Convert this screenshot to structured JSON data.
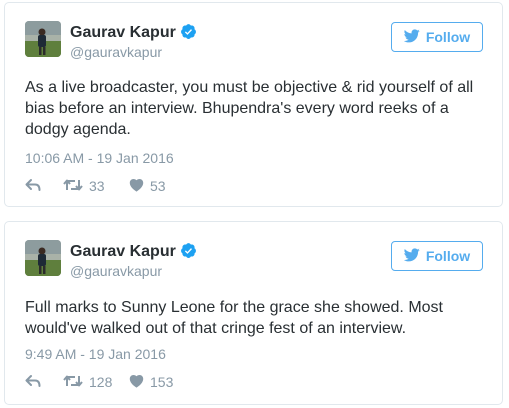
{
  "tweets": [
    {
      "user": {
        "name": "Gaurav Kapur",
        "handle": "@gauravkapur"
      },
      "follow_label": "Follow",
      "text": "As a live broadcaster, you must be objective & rid yourself of all bias before an interview. Bhupendra's every word reeks of a dodgy agenda.",
      "timestamp": "10:06 AM - 19 Jan 2016",
      "retweets": "33",
      "likes": "53"
    },
    {
      "user": {
        "name": "Gaurav Kapur",
        "handle": "@gauravkapur"
      },
      "follow_label": "Follow",
      "text": "Full marks to Sunny Leone for the grace she showed. Most would've walked out of that cringe fest of an interview.",
      "timestamp": "9:49 AM - 19 Jan 2016",
      "retweets": "128",
      "likes": "153"
    }
  ],
  "icons": {
    "verified": "verified-badge-icon",
    "bird": "twitter-bird-icon",
    "reply": "reply-icon",
    "retweet": "retweet-icon",
    "like": "heart-icon"
  },
  "colors": {
    "accent": "#55acee",
    "verified": "#1da1f2",
    "text": "#292f33",
    "muted": "#8899a6",
    "border": "#e1e8ed"
  }
}
